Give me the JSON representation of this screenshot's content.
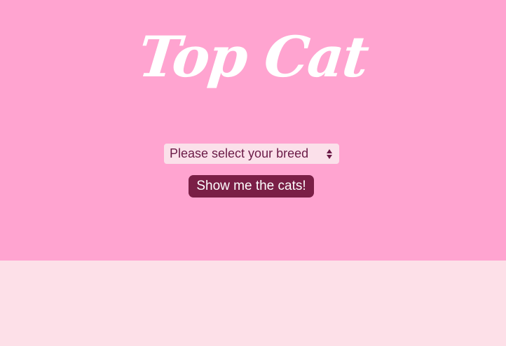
{
  "header": {
    "title": "Top Cat"
  },
  "form": {
    "breed_select": {
      "selected": "Please select your breed",
      "icon": "up-down-arrows-icon"
    },
    "submit_label": "Show me the cats!"
  },
  "colors": {
    "hero_background": "#ffa4d0",
    "page_background": "#fde0e8",
    "select_background": "#fbe0ea",
    "button_background": "#7a1f46",
    "title_text": "#ffffff",
    "select_text": "#6b1b47"
  }
}
